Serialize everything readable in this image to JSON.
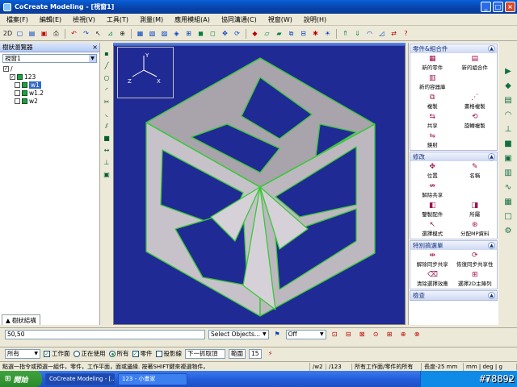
{
  "window": {
    "title": "CoCreate Modeling - [視窗1]",
    "btn_min": "_",
    "btn_max": "□",
    "btn_close": "×"
  },
  "menu": [
    "檔案(F)",
    "編輯(E)",
    "檢視(V)",
    "工具(T)",
    "測量(M)",
    "應用模組(A)",
    "協同溝通(C)",
    "視窗(W)",
    "說明(H)"
  ],
  "toolbar": {
    "view_label": "2D"
  },
  "tree_panel": {
    "title": "樹狀瀏覽器",
    "combo_value": "視窗1",
    "close_glyph": "×",
    "items": [
      {
        "label": "/",
        "checked": "✓",
        "selected": false
      },
      {
        "label": "123",
        "checked": "✓",
        "selected": false
      },
      {
        "label": "w1",
        "checked": "",
        "selected": true
      },
      {
        "label": "w1.2",
        "checked": "",
        "selected": false
      },
      {
        "label": "w2",
        "checked": "",
        "selected": false
      }
    ],
    "tab_label": "樹狀結構"
  },
  "right_panel": {
    "section1": {
      "title": "零件&組合件",
      "items": [
        "新的零件",
        "新的組合件",
        "新的容器庫",
        "",
        "複製",
        "畫格複製",
        "共享",
        "旋轉複製",
        "鏡射",
        ""
      ]
    },
    "section2": {
      "title": "修改",
      "items": [
        "位置",
        "名稱",
        "解除共享",
        "",
        "鑒製配件",
        "所屬",
        "選擇模式",
        "分配MP資料"
      ]
    },
    "section3": {
      "title": "特別搞選單",
      "items": [
        "解除同步共享",
        "恢復同步共享性",
        "清除選擇效應",
        "選擇2D主陣列"
      ]
    },
    "section4": {
      "title": "檢查"
    }
  },
  "cmd_row": {
    "input_value": "50,50",
    "select_objects": "Select Objects...",
    "off_value": "Off"
  },
  "options_row": {
    "scope_value": "所有",
    "workplane": "工作面",
    "in_use": "正在使用",
    "all": "所有",
    "parts": "零件",
    "projection": "投影線",
    "catch": "下一抓取頂",
    "range": "範圍",
    "range_value": "15"
  },
  "status": {
    "hint": "點選一指令或預選一組件，零件，工作平面，面或邊緣. 按著SHIFT鍵來複選物件。",
    "counter": "/w2",
    "part_path": "/123",
    "scope": "所有工作面/零件的所有",
    "units": "長度-25 mm",
    "unit_list": "mm | deg | g"
  },
  "taskbar": {
    "start": "開始",
    "task1": "CoCreate Modeling - [...",
    "task2": "123 - 小畫家",
    "watermark": "#78892"
  }
}
